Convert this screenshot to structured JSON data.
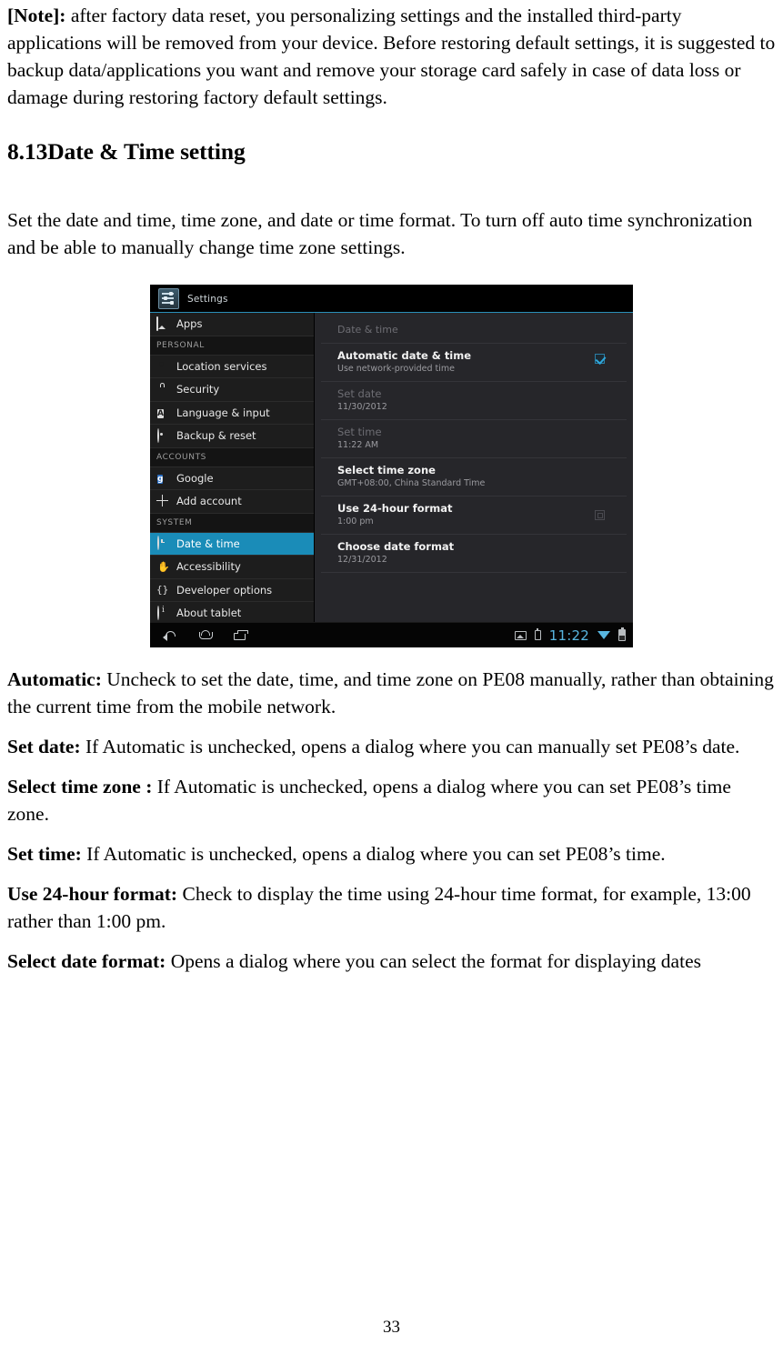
{
  "document": {
    "note": {
      "label": "[Note]:",
      "text": " after factory data reset, you personalizing settings and the installed third-party applications will be removed from your device. Before restoring default settings, it is suggested to backup data/applications you want and remove your storage card safely in case of data loss or damage during restoring factory default settings."
    },
    "heading": "8.13Date & Time setting",
    "intro": "Set the date and time, time zone, and date or time format. To turn off auto time synchronization and be able to manually change time zone settings.",
    "definitions": [
      {
        "term": "Automatic:",
        "desc": " Uncheck to set the date, time, and time zone on PE08 manually, rather than obtaining the current time from the mobile network."
      },
      {
        "term": "Set date:",
        "desc": " If Automatic is unchecked, opens a dialog where you can manually set PE08’s date."
      },
      {
        "term": "Select time zone :",
        "desc": " If Automatic is unchecked, opens a dialog where you can set PE08’s time zone."
      },
      {
        "term": "Set time:",
        "desc": " If Automatic is unchecked, opens a dialog where you can set PE08’s time."
      },
      {
        "term": "Use 24-hour format:",
        "desc": " Check to display the time using 24-hour time format, for example, 13:00 rather than 1:00 pm."
      },
      {
        "term": "Select date format:",
        "desc": " Opens a dialog where you can select the format for displaying dates"
      }
    ],
    "page_number": "33"
  },
  "screenshot": {
    "titlebar": {
      "app_icon": "settings-sliders-icon",
      "app_title": "Settings"
    },
    "sidebar": {
      "items": [
        {
          "type": "item",
          "label": "Apps",
          "icon": "apps-image-icon",
          "selected": false
        },
        {
          "type": "header",
          "label": "PERSONAL"
        },
        {
          "type": "item",
          "label": "Location services",
          "icon": "location-pin-icon",
          "selected": false
        },
        {
          "type": "item",
          "label": "Security",
          "icon": "lock-icon",
          "selected": false
        },
        {
          "type": "item",
          "label": "Language & input",
          "icon": "language-a-icon",
          "selected": false
        },
        {
          "type": "item",
          "label": "Backup & reset",
          "icon": "backup-circle-icon",
          "selected": false
        },
        {
          "type": "header",
          "label": "ACCOUNTS"
        },
        {
          "type": "item",
          "label": "Google",
          "icon": "google-icon",
          "selected": false
        },
        {
          "type": "item",
          "label": "Add account",
          "icon": "plus-icon",
          "selected": false
        },
        {
          "type": "header",
          "label": "SYSTEM"
        },
        {
          "type": "item",
          "label": "Date & time",
          "icon": "clock-icon",
          "selected": true
        },
        {
          "type": "item",
          "label": "Accessibility",
          "icon": "hand-icon",
          "selected": false
        },
        {
          "type": "item",
          "label": "Developer options",
          "icon": "braces-icon",
          "selected": false
        },
        {
          "type": "item",
          "label": "About tablet",
          "icon": "info-icon",
          "selected": false
        }
      ]
    },
    "panel": {
      "title": "Date & time",
      "rows": [
        {
          "title": "Automatic date & time",
          "subtitle": "Use network-provided time",
          "dim": false,
          "checkbox": "checked"
        },
        {
          "title": "Set date",
          "subtitle": "11/30/2012",
          "dim": true,
          "checkbox": "none"
        },
        {
          "title": "Set time",
          "subtitle": "11:22 AM",
          "dim": true,
          "checkbox": "none"
        },
        {
          "title": "Select time zone",
          "subtitle": "GMT+08:00, China Standard Time",
          "dim": false,
          "checkbox": "none"
        },
        {
          "title": "Use 24-hour format",
          "subtitle": "1:00 pm",
          "dim": false,
          "checkbox": "unchecked"
        },
        {
          "title": "Choose date format",
          "subtitle": "12/31/2012",
          "dim": false,
          "checkbox": "none"
        }
      ]
    },
    "systembar": {
      "nav": [
        {
          "icon": "back-icon"
        },
        {
          "icon": "home-icon"
        },
        {
          "icon": "recent-apps-icon"
        }
      ],
      "status": {
        "screenshot_icon": "screenshot-icon",
        "usb_icon": "usb-icon",
        "clock": "11:22",
        "wifi_icon": "wifi-icon",
        "battery_icon": "battery-icon"
      }
    },
    "colors": {
      "accent": "#1a8cb8",
      "clock_blue": "#58b6e0",
      "panel_bg": "#26262a",
      "sidebar_bg": "#1d1d1d"
    }
  }
}
